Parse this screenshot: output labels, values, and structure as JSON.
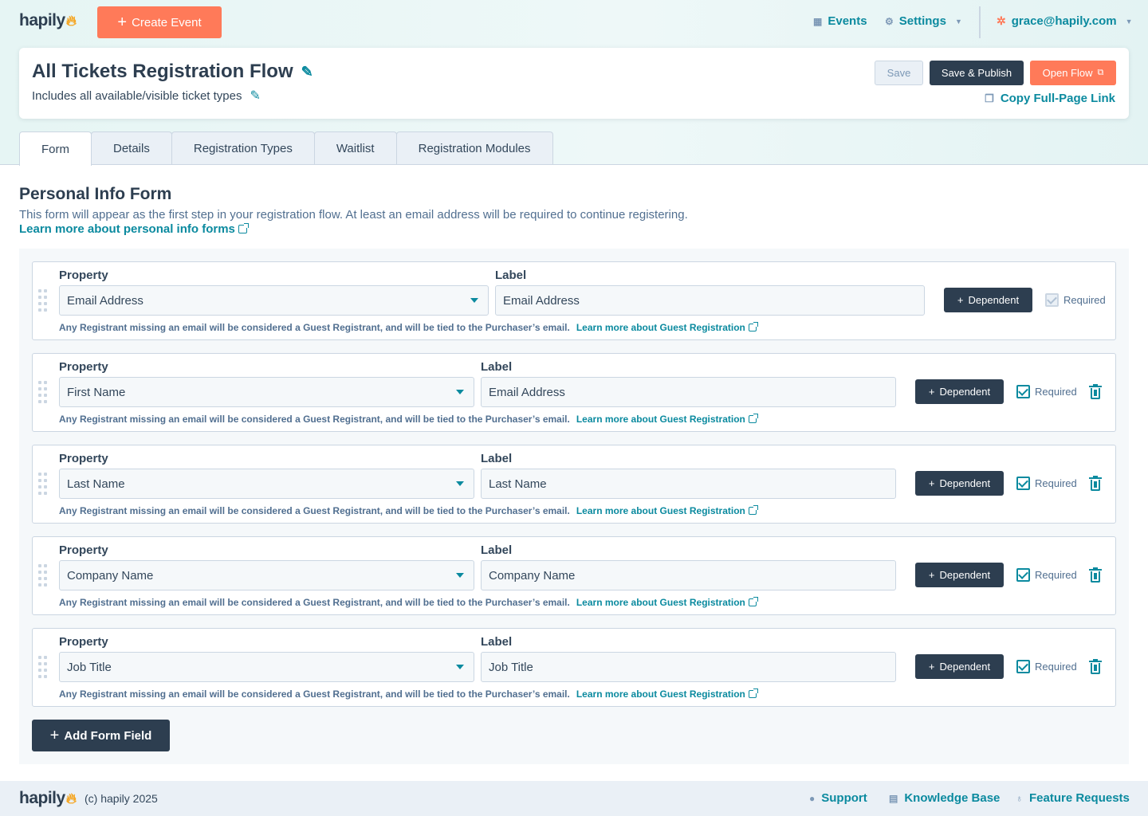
{
  "brand": {
    "name": "hapily",
    "accent": "#ff7a59",
    "link_color": "#0b8a9f",
    "dark": "#2d3e50"
  },
  "topnav": {
    "create_event": "Create Event",
    "events": "Events",
    "settings": "Settings",
    "user_email": "grace@hapily.com"
  },
  "header": {
    "title": "All Tickets Registration Flow",
    "subtitle": "Includes all available/visible ticket types",
    "save": "Save",
    "save_publish": "Save & Publish",
    "open_flow": "Open Flow",
    "copy_link": "Copy Full-Page Link"
  },
  "tabs": [
    {
      "label": "Form",
      "active": true
    },
    {
      "label": "Details"
    },
    {
      "label": "Registration Types"
    },
    {
      "label": "Waitlist"
    },
    {
      "label": "Registration Modules"
    }
  ],
  "section": {
    "title": "Personal Info Form",
    "description": "This form will appear as the first step in your registration flow. At least an email address will be required to continue registering.",
    "learn_more": "Learn more about personal info forms"
  },
  "field_labels": {
    "property": "Property",
    "label": "Label",
    "dependent": "Dependent",
    "required": "Required",
    "hint": "Any Registrant missing an email will be considered a Guest Registrant, and will be tied to the Purchaser’s email.",
    "hint_link": "Learn more about Guest Registration"
  },
  "fields": [
    {
      "property": "Email Address",
      "label": "Email Address",
      "required": true,
      "locked": true
    },
    {
      "property": "First Name",
      "label": "Email Address",
      "required": true
    },
    {
      "property": "Last Name",
      "label": "Last Name",
      "required": true
    },
    {
      "property": "Company Name",
      "label": "Company Name",
      "required": true
    },
    {
      "property": "Job Title",
      "label": "Job Title",
      "required": true
    }
  ],
  "add_field": "Add Form Field",
  "footer": {
    "copyright": "(c) hapily 2025",
    "support": "Support",
    "knowledge_base": "Knowledge Base",
    "feature_requests": "Feature Requests"
  }
}
